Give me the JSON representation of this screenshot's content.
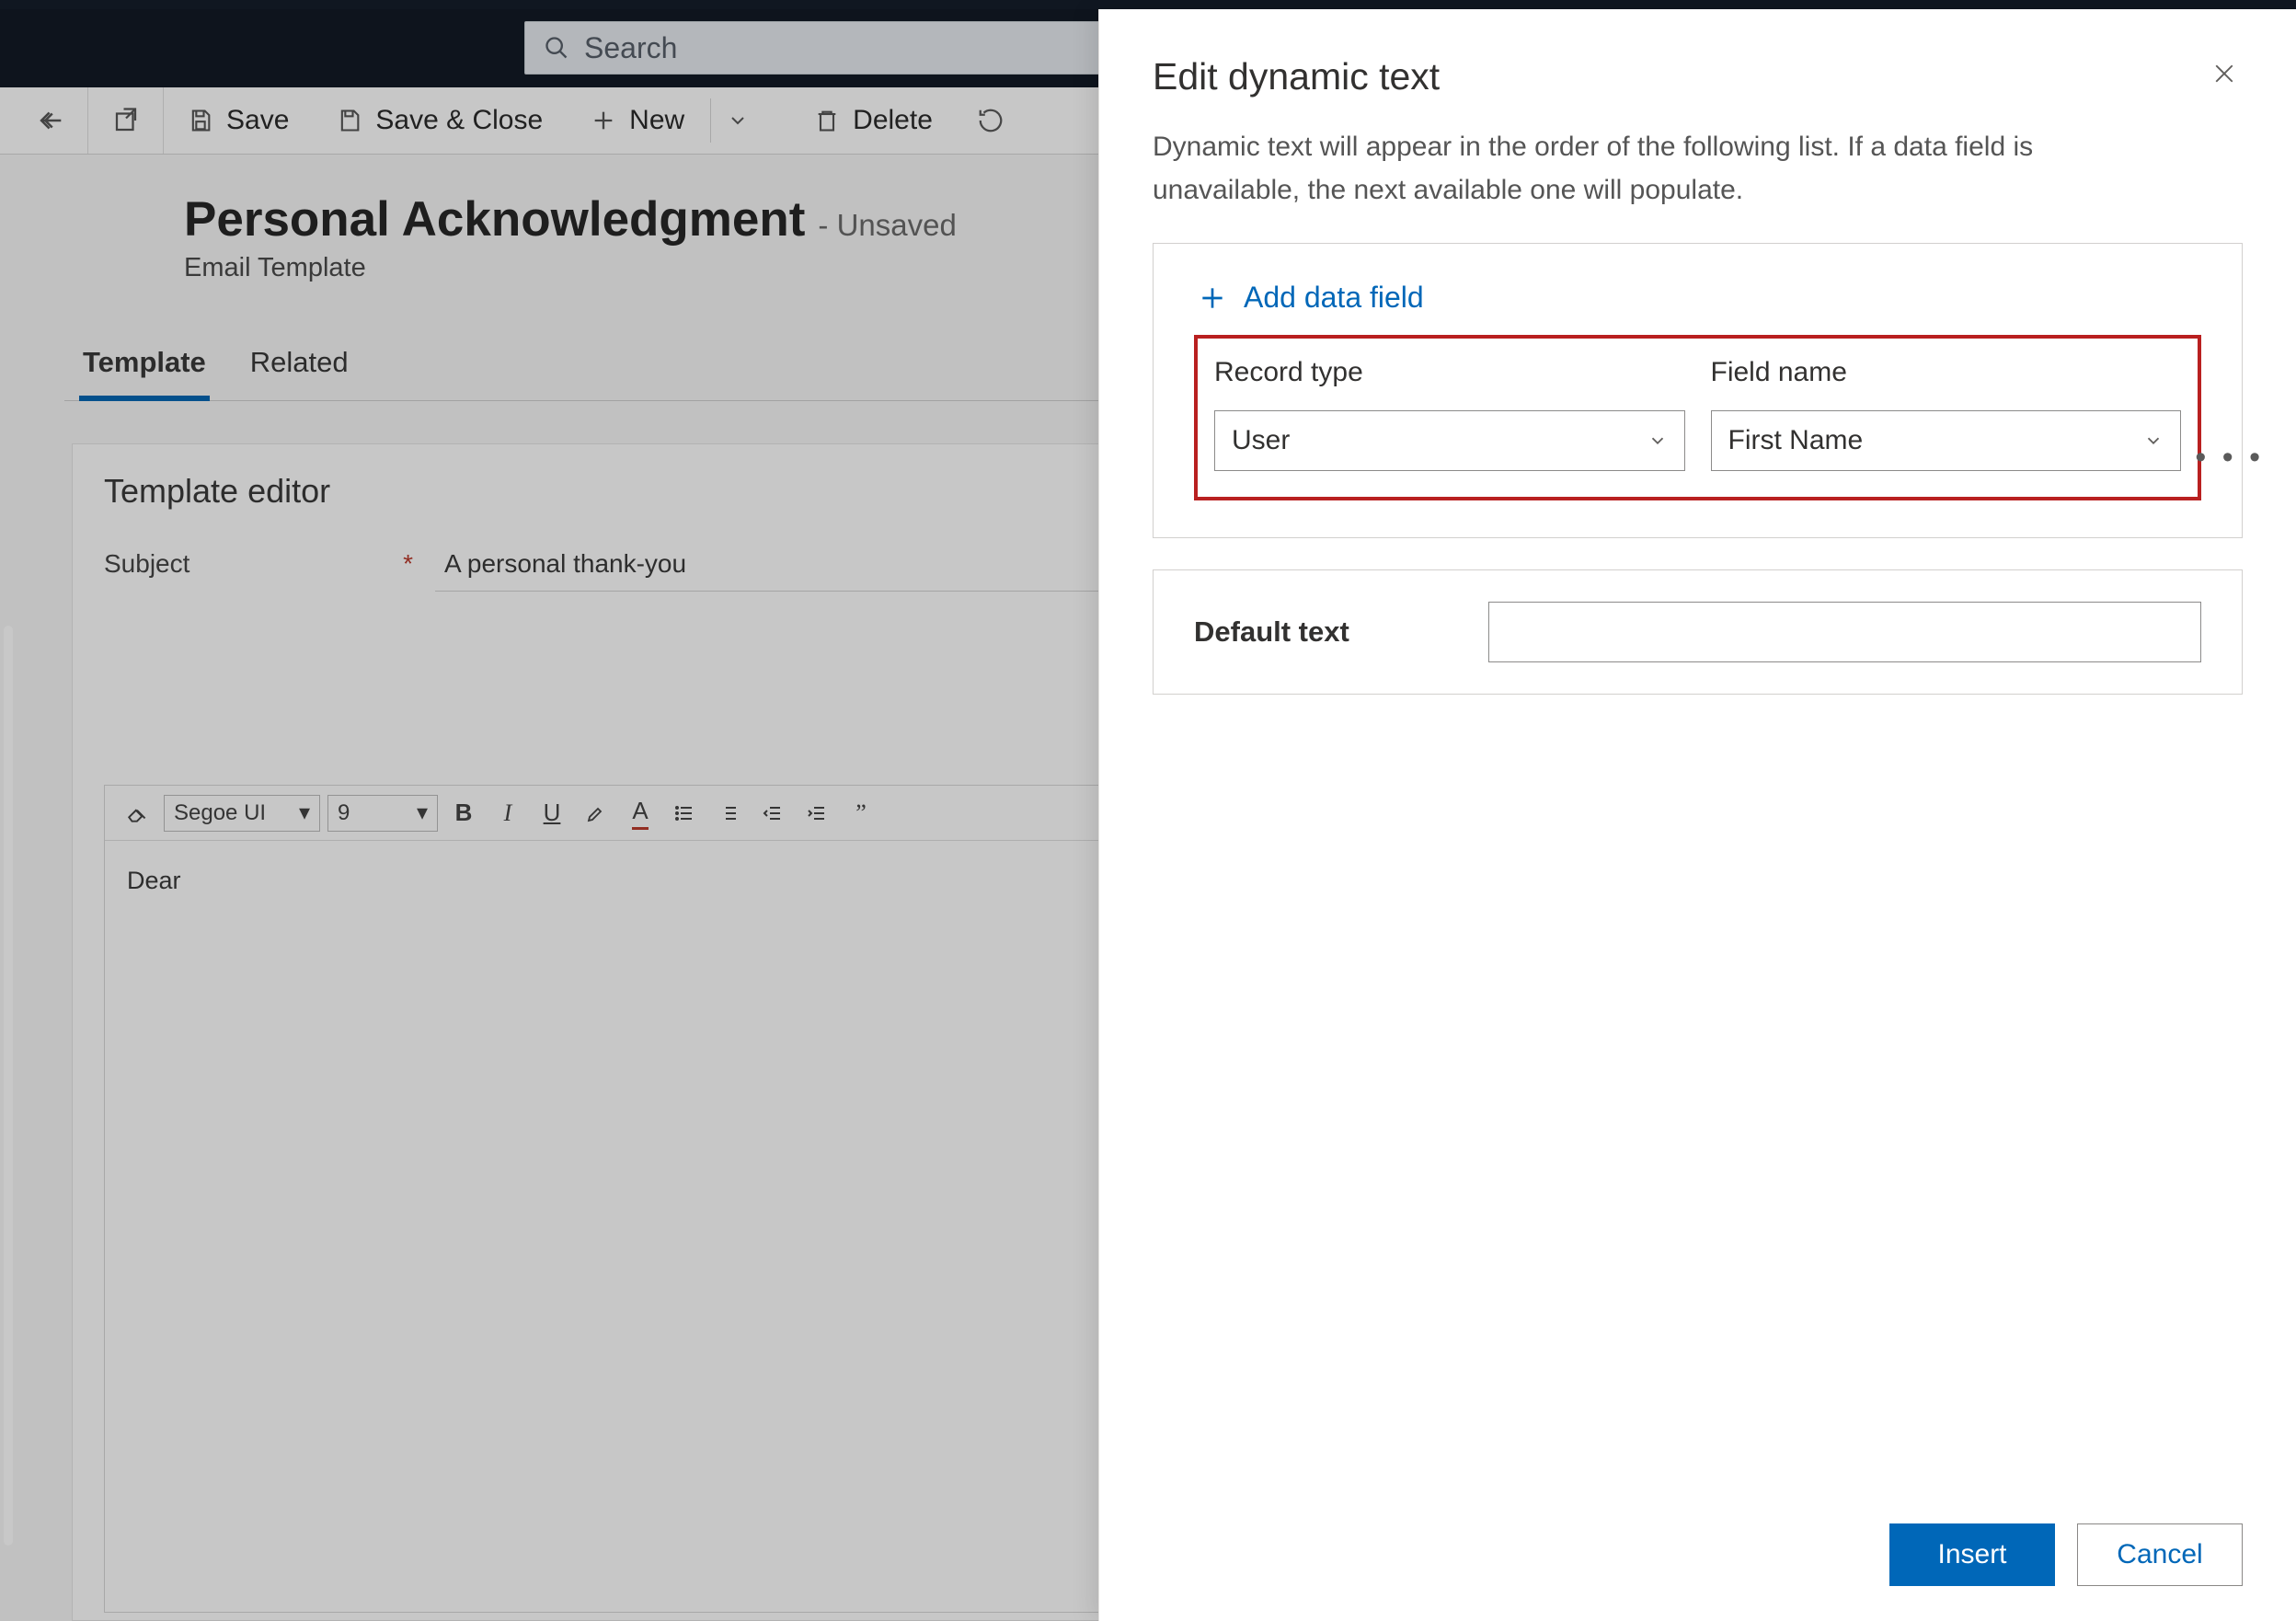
{
  "search": {
    "placeholder": "Search"
  },
  "commandbar": {
    "save": "Save",
    "save_close": "Save & Close",
    "newItem": "New",
    "deleteItem": "Delete"
  },
  "page": {
    "title": "Personal Acknowledgment",
    "status": "- Unsaved",
    "subtitle": "Email Template"
  },
  "tabs": {
    "template": "Template",
    "related": "Related"
  },
  "form": {
    "section": "Template editor",
    "subject_label": "Subject",
    "subject_value": "A personal thank-you"
  },
  "editor": {
    "font": "Segoe UI",
    "size": "9",
    "body": "Dear"
  },
  "panel": {
    "title": "Edit dynamic text",
    "help": "Dynamic text will appear in the order of the following list. If a data field is unavailable, the next available one will populate.",
    "add_field": "Add data field",
    "col_record_type": "Record type",
    "col_field_name": "Field name",
    "record_type_value": "User",
    "field_name_value": "First Name",
    "default_text_label": "Default text",
    "default_text_value": "",
    "insert": "Insert",
    "cancel": "Cancel"
  }
}
